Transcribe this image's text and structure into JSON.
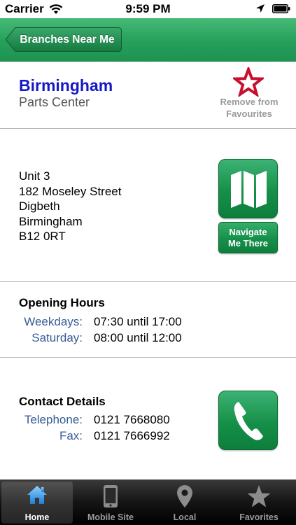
{
  "status_bar": {
    "carrier": "Carrier",
    "time": "9:59 PM"
  },
  "nav": {
    "back_label": "Branches Near Me"
  },
  "branch": {
    "name": "Birmingham",
    "type": "Parts Center",
    "favourite_line1": "Remove from",
    "favourite_line2": "Favourites"
  },
  "address": {
    "lines": [
      "Unit 3",
      "182 Moseley Street",
      "Digbeth",
      "Birmingham",
      "B12 0RT"
    ],
    "navigate_line1": "Navigate",
    "navigate_line2": "Me There"
  },
  "hours": {
    "title": "Opening Hours",
    "rows": [
      {
        "day": "Weekdays:",
        "time": "07:30 until 17:00"
      },
      {
        "day": "Saturday:",
        "time": "08:00 until 12:00"
      }
    ]
  },
  "contact": {
    "title": "Contact Details",
    "rows": [
      {
        "label": "Telephone:",
        "value": "0121 7668080"
      },
      {
        "label": "Fax:",
        "value": "0121 7666992"
      }
    ]
  },
  "tabs": [
    {
      "label": "Home",
      "icon": "home-icon",
      "active": true
    },
    {
      "label": "Mobile Site",
      "icon": "phone-device-icon",
      "active": false
    },
    {
      "label": "Local",
      "icon": "location-pin-icon",
      "active": false
    },
    {
      "label": "Favorites",
      "icon": "star-icon",
      "active": false
    }
  ],
  "colors": {
    "nav_green": "#25a05b",
    "branch_blue": "#1518c8",
    "label_blue": "#385c96",
    "star_red": "#c8102e"
  }
}
